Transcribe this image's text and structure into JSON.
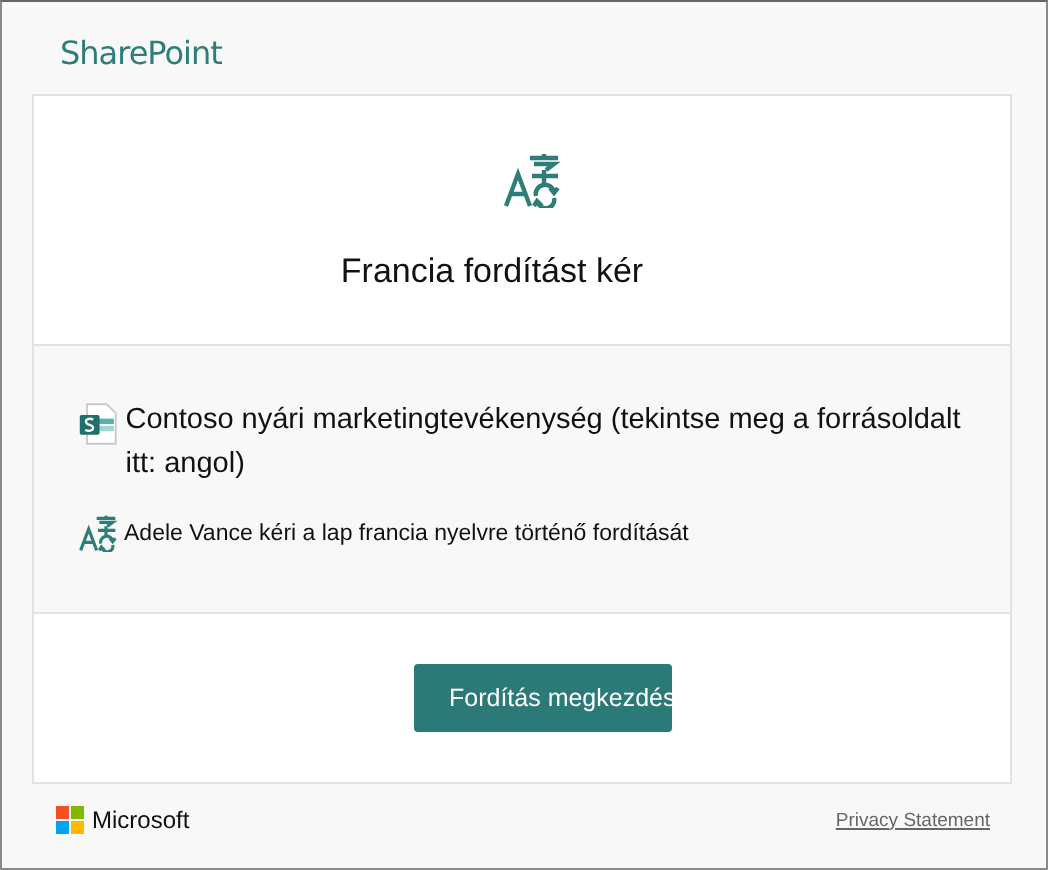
{
  "header": {
    "brand": "SharePoint"
  },
  "request": {
    "title": "Francia fordítást kér"
  },
  "details": {
    "page_title": "Contoso nyári marketingtevékenység (tekintse meg a forrásoldalt itt: angol)",
    "requester_line": "Adele Vance kéri a lap francia nyelvre történő fordítását"
  },
  "actions": {
    "button": "Fordítás megkezdés"
  },
  "footer": {
    "company": "Microsoft",
    "link": "Privacy Statement"
  }
}
